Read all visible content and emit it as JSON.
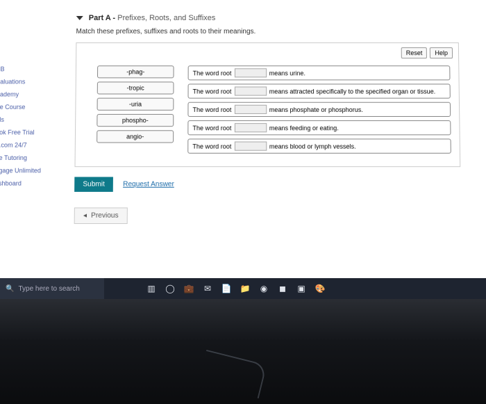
{
  "sidebar": {
    "items": [
      {
        "label": "B"
      },
      {
        "label": "aluations"
      },
      {
        "label": "ademy"
      },
      {
        "label": "e Course"
      },
      {
        "label": "ls"
      },
      {
        "label": "ok Free Trial"
      },
      {
        "label": ".com 24/7"
      },
      {
        "label": "e Tutoring"
      },
      {
        "label": "gage Unlimited"
      },
      {
        "label": "shboard"
      }
    ]
  },
  "part": {
    "label": "Part A",
    "subtitle": "Prefixes, Roots, and Suffixes"
  },
  "instruction": "Match these prefixes, suffixes and roots to their meanings.",
  "panel": {
    "reset": "Reset",
    "help": "Help"
  },
  "terms": [
    {
      "label": "-phag-"
    },
    {
      "label": "-tropic"
    },
    {
      "label": "-uria"
    },
    {
      "label": "phospho-"
    },
    {
      "label": "angio-"
    }
  ],
  "defs": [
    {
      "pre": "The word root",
      "post": "means urine."
    },
    {
      "pre": "The word root",
      "post": "means attracted specifically to the specified organ or tissue."
    },
    {
      "pre": "The word root",
      "post": "means phosphate or phosphorus."
    },
    {
      "pre": "The word root",
      "post": "means feeding or eating."
    },
    {
      "pre": "The word root",
      "post": "means blood or lymph vessels."
    }
  ],
  "actions": {
    "submit": "Submit",
    "request": "Request Answer",
    "previous": "Previous"
  },
  "taskbar": {
    "search_placeholder": "Type here to search"
  }
}
